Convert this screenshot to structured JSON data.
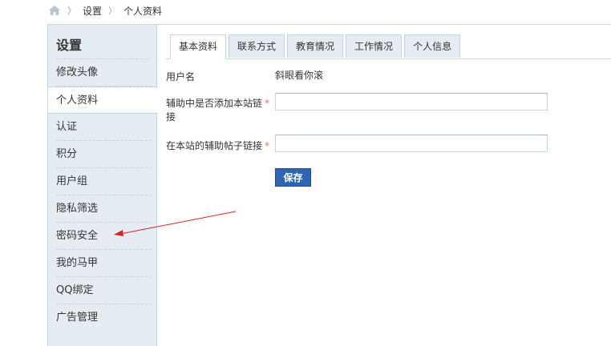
{
  "breadcrumb": {
    "items": [
      "设置",
      "个人资料"
    ],
    "separator": "〉"
  },
  "sidebar": {
    "title": "设置",
    "items": [
      {
        "label": "修改头像"
      },
      {
        "label": "个人资料",
        "active": true
      },
      {
        "label": "认证"
      },
      {
        "label": "积分"
      },
      {
        "label": "用户组"
      },
      {
        "label": "隐私筛选"
      },
      {
        "label": "密码安全"
      },
      {
        "label": "我的马甲"
      },
      {
        "label": "QQ绑定"
      },
      {
        "label": "广告管理"
      }
    ]
  },
  "tabs": [
    {
      "label": "基本资料",
      "active": true
    },
    {
      "label": "联系方式"
    },
    {
      "label": "教育情况"
    },
    {
      "label": "工作情况"
    },
    {
      "label": "个人信息"
    }
  ],
  "form": {
    "username_label": "用户名",
    "username_value": "斜眼看你滚",
    "field1_label_line1": "辅助中是否添加本站链",
    "field1_label_line2": "接",
    "field1_value": "",
    "field2_label": "在本站的辅助帖子链接",
    "field2_value": "",
    "required_mark": "*",
    "save_label": "保存"
  },
  "colors": {
    "sidebar_bg": "#e5edf2",
    "border": "#c2d5e3",
    "button": "#2e65b3",
    "required": "#f26c4f",
    "annotation_arrow": "#e02020"
  }
}
